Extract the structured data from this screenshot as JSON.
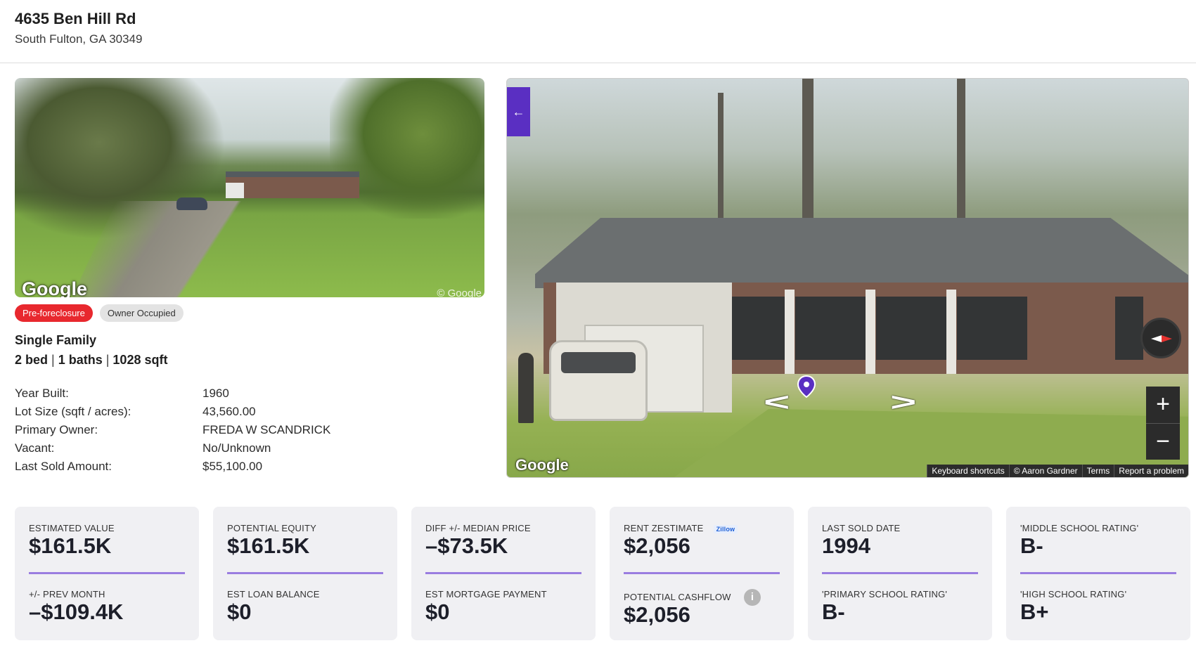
{
  "header": {
    "title": "4635 Ben Hill Rd",
    "subtitle": "South Fulton, GA 30349"
  },
  "photo": {
    "google_logo": "Google",
    "copyright": "© Google"
  },
  "badges": {
    "status": "Pre-foreclosure",
    "occupancy": "Owner Occupied",
    "status_color": "#e8282e"
  },
  "property": {
    "type": "Single Family",
    "beds": "2 bed",
    "baths": "1 baths",
    "sqft": "1028 sqft",
    "sep": "|"
  },
  "details": [
    {
      "label": "Year Built:",
      "value": "1960"
    },
    {
      "label": "Lot Size (sqft / acres):",
      "value": "43,560.00"
    },
    {
      "label": "Primary Owner:",
      "value": "FREDA W SCANDRICK"
    },
    {
      "label": "Vacant:",
      "value": "No/Unknown"
    },
    {
      "label": "Last Sold Amount:",
      "value": "$55,100.00"
    }
  ],
  "streetview": {
    "back_icon": "←",
    "arrow_left": "<",
    "arrow_right": ">",
    "zoom_in": "+",
    "zoom_out": "−",
    "google_logo": "Google",
    "footer": [
      "Keyboard shortcuts",
      "© Aaron Gardner",
      "Terms",
      "Report a problem"
    ],
    "accent": "#5a2fc2"
  },
  "cards": [
    {
      "top_label": "ESTIMATED VALUE",
      "top_value": "$161.5K",
      "bottom_label": "+/- PREV MONTH",
      "bottom_value": "–$109.4K"
    },
    {
      "top_label": "POTENTIAL EQUITY",
      "top_value": "$161.5K",
      "bottom_label": "EST LOAN BALANCE",
      "bottom_value": "$0"
    },
    {
      "top_label": "DIFF +/- MEDIAN PRICE",
      "top_value": "–$73.5K",
      "bottom_label": "EST MORTGAGE PAYMENT",
      "bottom_value": "$0"
    },
    {
      "top_label": "RENT ZESTIMATE",
      "badge": "Zillow",
      "top_value": "$2,056",
      "bottom_label": "POTENTIAL CASHFLOW",
      "bottom_value": "$2,056",
      "info_icon": "i"
    },
    {
      "top_label": "LAST SOLD DATE",
      "top_value": "1994",
      "bottom_label": "'PRIMARY SCHOOL RATING'",
      "bottom_value": "B-"
    },
    {
      "top_label": "'MIDDLE SCHOOL RATING'",
      "top_value": "B-",
      "bottom_label": "'HIGH SCHOOL RATING'",
      "bottom_value": "B+"
    }
  ],
  "colors": {
    "card_bg": "#f0f0f3",
    "divider": "#9a7de0"
  }
}
